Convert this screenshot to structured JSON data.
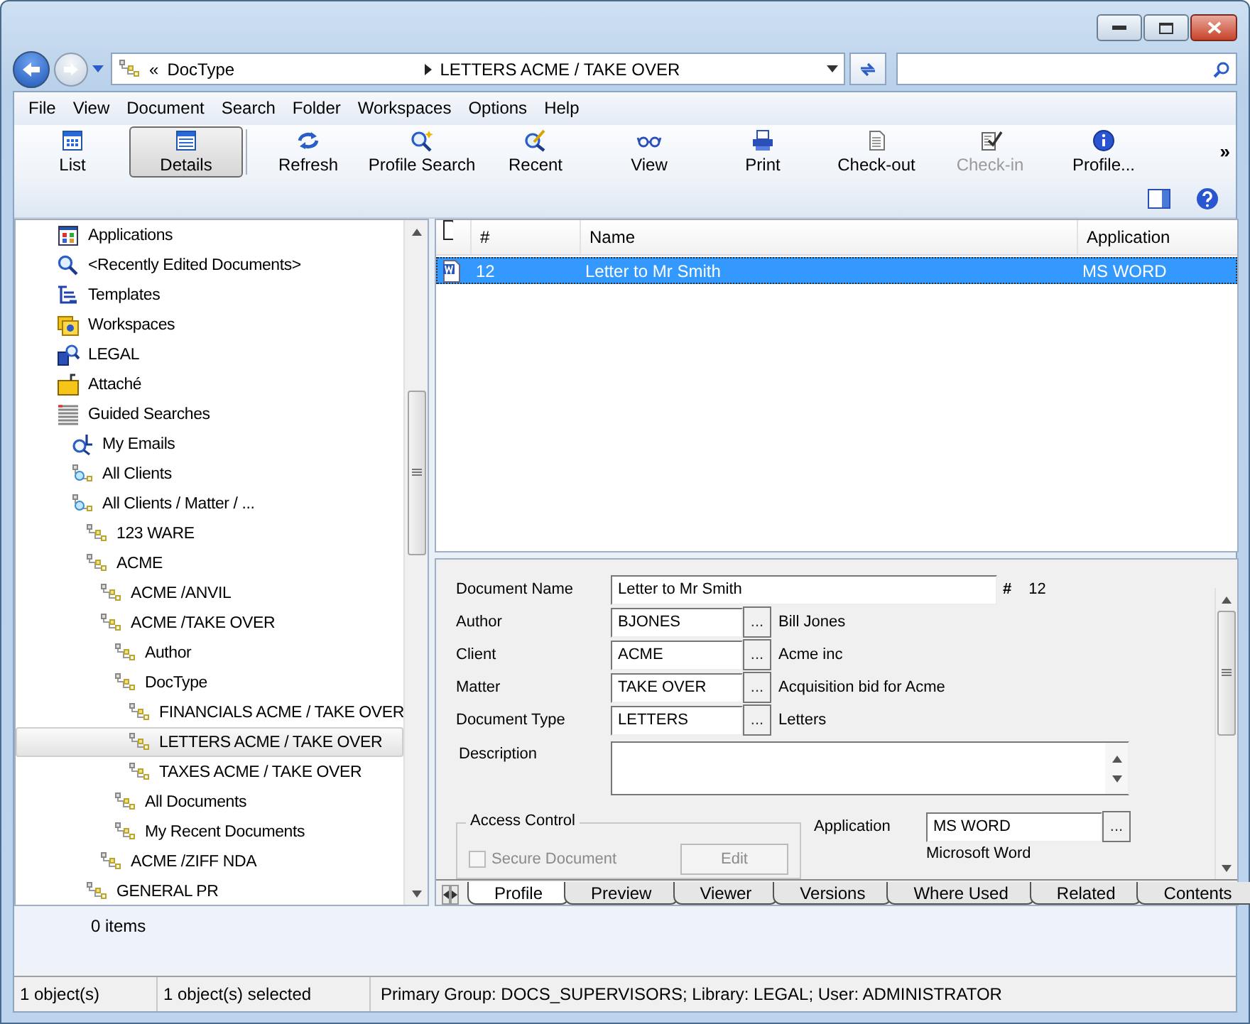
{
  "address_bar": {
    "overflow": "«",
    "segments": [
      "DocType",
      "LETTERS ACME / TAKE OVER"
    ]
  },
  "menu": [
    "File",
    "View",
    "Document",
    "Search",
    "Folder",
    "Workspaces",
    "Options",
    "Help"
  ],
  "toolbar": {
    "buttons": [
      {
        "label": "List",
        "kind": "list",
        "selected": false,
        "disabled": false
      },
      {
        "label": "Details",
        "kind": "details",
        "selected": true,
        "disabled": false
      },
      {
        "label": "Refresh",
        "kind": "refresh",
        "selected": false,
        "disabled": false
      },
      {
        "label": "Profile Search",
        "kind": "profilesearch",
        "selected": false,
        "disabled": false
      },
      {
        "label": "Recent",
        "kind": "recent",
        "selected": false,
        "disabled": false
      },
      {
        "label": "View",
        "kind": "view",
        "selected": false,
        "disabled": false
      },
      {
        "label": "Print",
        "kind": "print",
        "selected": false,
        "disabled": false
      },
      {
        "label": "Check-out",
        "kind": "checkout",
        "selected": false,
        "disabled": false
      },
      {
        "label": "Check-in",
        "kind": "checkin",
        "selected": false,
        "disabled": true
      },
      {
        "label": "Profile...",
        "kind": "profile",
        "selected": false,
        "disabled": false
      }
    ],
    "overflow": "»"
  },
  "tree": [
    {
      "label": "Applications",
      "kind": "applications",
      "selected": false
    },
    {
      "label": "<Recently Edited Documents>",
      "kind": "recent",
      "selected": false
    },
    {
      "label": "Templates",
      "kind": "templates",
      "selected": false
    },
    {
      "label": "Workspaces",
      "kind": "workspaces",
      "selected": false
    },
    {
      "label": "LEGAL",
      "kind": "library",
      "selected": false
    },
    {
      "label": "Attaché",
      "kind": "attache",
      "selected": false
    },
    {
      "label": "Guided Searches",
      "kind": "guided",
      "selected": false,
      "children": [
        {
          "label": "My Emails",
          "kind": "email",
          "selected": false
        },
        {
          "label": "All Clients",
          "kind": "clients",
          "selected": false
        },
        {
          "label": "All Clients / Matter / ...",
          "kind": "clients",
          "selected": false,
          "children": [
            {
              "label": "123 WARE",
              "kind": "node",
              "selected": false
            },
            {
              "label": "ACME",
              "kind": "node",
              "selected": false,
              "children": [
                {
                  "label": "ACME /ANVIL",
                  "kind": "node",
                  "selected": false
                },
                {
                  "label": "ACME /TAKE OVER",
                  "kind": "node",
                  "selected": false,
                  "children": [
                    {
                      "label": "Author",
                      "kind": "node",
                      "selected": false
                    },
                    {
                      "label": "DocType",
                      "kind": "node",
                      "selected": false,
                      "children": [
                        {
                          "label": "FINANCIALS ACME / TAKE OVER",
                          "kind": "node",
                          "selected": false
                        },
                        {
                          "label": "LETTERS ACME / TAKE OVER",
                          "kind": "node",
                          "selected": true
                        },
                        {
                          "label": "TAXES ACME / TAKE OVER",
                          "kind": "node",
                          "selected": false
                        }
                      ]
                    },
                    {
                      "label": "All Documents",
                      "kind": "node",
                      "selected": false
                    },
                    {
                      "label": "My Recent Documents",
                      "kind": "node",
                      "selected": false
                    }
                  ]
                },
                {
                  "label": "ACME /ZIFF NDA",
                  "kind": "node",
                  "selected": false
                }
              ]
            },
            {
              "label": "GENERAL PR",
              "kind": "node",
              "selected": false
            }
          ]
        }
      ]
    }
  ],
  "document_list": {
    "columns": [
      "#",
      "Name",
      "Application"
    ],
    "rows": [
      {
        "number": "12",
        "name": "Letter to Mr Smith",
        "application": "MS WORD",
        "selected": true
      }
    ]
  },
  "profile": {
    "name_field": {
      "label": "Document Name",
      "value": "Letter to Mr Smith",
      "number_label": "#",
      "number": "12"
    },
    "lookups": [
      {
        "label": "Author",
        "value": "BJONES",
        "button": "...",
        "description": "Bill Jones"
      },
      {
        "label": "Client",
        "value": "ACME",
        "button": "...",
        "description": "Acme inc"
      },
      {
        "label": "Matter",
        "value": "TAKE OVER",
        "button": "...",
        "description": "Acquisition bid for Acme"
      },
      {
        "label": "Document Type",
        "value": "LETTERS",
        "button": "...",
        "description": "Letters"
      }
    ],
    "description_label": "Description",
    "access_control": {
      "title": "Access Control",
      "secure_document": {
        "label": "Secure Document",
        "checked": false,
        "disabled": true
      },
      "edit_button": {
        "label": "Edit",
        "disabled": true
      }
    },
    "application": {
      "label": "Application",
      "value": "MS WORD",
      "button": "...",
      "description": "Microsoft Word"
    }
  },
  "tabs": [
    {
      "label": "Profile",
      "selected": true
    },
    {
      "label": "Preview",
      "selected": false
    },
    {
      "label": "Viewer",
      "selected": false
    },
    {
      "label": "Versions",
      "selected": false
    },
    {
      "label": "Where Used",
      "selected": false
    },
    {
      "label": "Related",
      "selected": false
    },
    {
      "label": "Contents",
      "selected": false
    }
  ],
  "items_count": "0 items",
  "status_bar": [
    "1 object(s)",
    "1 object(s) selected",
    "Primary Group: DOCS_SUPERVISORS;  Library: LEGAL;  User: ADMINISTRATOR"
  ]
}
